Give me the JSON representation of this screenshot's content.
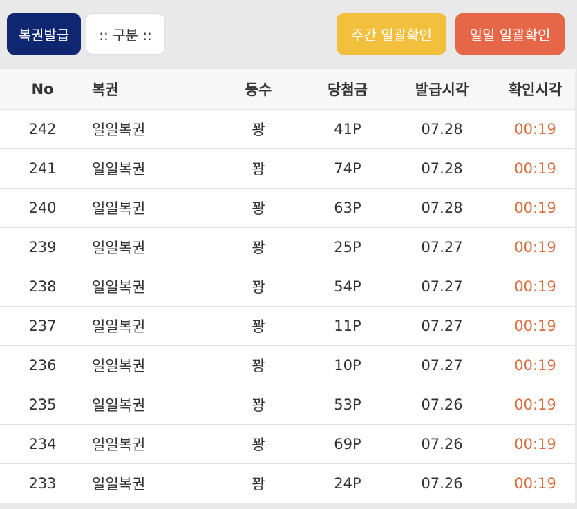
{
  "toolbar": {
    "issue_label": "복권발급",
    "filter_label": ":: 구분 ::",
    "weekly_confirm_label": "주간 일괄확인",
    "daily_confirm_label": "일일 일괄확인"
  },
  "colors": {
    "issue_button": "#0f2771",
    "weekly_button": "#f2c03c",
    "daily_button": "#e56747",
    "check_time_text": "#d9703f"
  },
  "table": {
    "headers": {
      "no": "No",
      "type": "복권",
      "rank": "등수",
      "prize": "당첨금",
      "issued_time": "발급시각",
      "checked_time": "확인시각"
    },
    "rows": [
      {
        "no": "242",
        "type": "일일복권",
        "rank": "꽝",
        "prize": "41P",
        "issued": "07.28",
        "checked": "00:19"
      },
      {
        "no": "241",
        "type": "일일복권",
        "rank": "꽝",
        "prize": "74P",
        "issued": "07.28",
        "checked": "00:19"
      },
      {
        "no": "240",
        "type": "일일복권",
        "rank": "꽝",
        "prize": "63P",
        "issued": "07.28",
        "checked": "00:19"
      },
      {
        "no": "239",
        "type": "일일복권",
        "rank": "꽝",
        "prize": "25P",
        "issued": "07.27",
        "checked": "00:19"
      },
      {
        "no": "238",
        "type": "일일복권",
        "rank": "꽝",
        "prize": "54P",
        "issued": "07.27",
        "checked": "00:19"
      },
      {
        "no": "237",
        "type": "일일복권",
        "rank": "꽝",
        "prize": "11P",
        "issued": "07.27",
        "checked": "00:19"
      },
      {
        "no": "236",
        "type": "일일복권",
        "rank": "꽝",
        "prize": "10P",
        "issued": "07.27",
        "checked": "00:19"
      },
      {
        "no": "235",
        "type": "일일복권",
        "rank": "꽝",
        "prize": "53P",
        "issued": "07.26",
        "checked": "00:19"
      },
      {
        "no": "234",
        "type": "일일복권",
        "rank": "꽝",
        "prize": "69P",
        "issued": "07.26",
        "checked": "00:19"
      },
      {
        "no": "233",
        "type": "일일복권",
        "rank": "꽝",
        "prize": "24P",
        "issued": "07.26",
        "checked": "00:19"
      }
    ]
  }
}
